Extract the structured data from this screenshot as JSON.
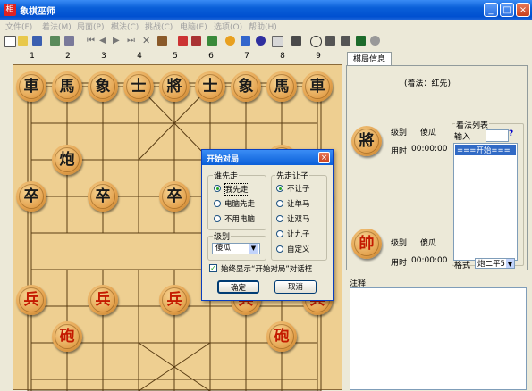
{
  "window": {
    "title": "象棋巫师",
    "app_icon_glyph": "相"
  },
  "menu": [
    "文件(F)",
    "着法(M)",
    "局面(P)",
    "棋法(C)",
    "挑战(C)",
    "电脑(E)",
    "选项(O)",
    "帮助(H)"
  ],
  "board": {
    "column_numbers": [
      "1",
      "2",
      "3",
      "4",
      "5",
      "6",
      "7",
      "8",
      "9"
    ],
    "black_back_row": [
      "車",
      "馬",
      "象",
      "士",
      "將",
      "士",
      "象",
      "馬",
      "車"
    ],
    "black_cannon": "炮",
    "black_soldier": "卒",
    "red_soldier": "兵",
    "red_cannon": "砲"
  },
  "right_panel": {
    "tab_label": "棋局信息",
    "moves_first": "(着法：红先)",
    "top_player": {
      "piece": "將",
      "level_label": "级别",
      "level_value": "傻瓜",
      "time_label": "用时",
      "time_value": "00:00:00"
    },
    "bottom_player": {
      "piece": "帥",
      "level_label": "级别",
      "level_value": "傻瓜",
      "time_label": "用时",
      "time_value": "00:00:00"
    },
    "moves_list_label": "着法列表",
    "input_label": "输入",
    "help_link": "?",
    "moves_list_items": [
      "===开始==="
    ],
    "format_label": "格式",
    "format_value": "炮二平5",
    "notes_label": "注释"
  },
  "dialog": {
    "title": "开始对局",
    "who_first_label": "谁先走",
    "who_first_options": [
      "我先走",
      "电脑先走",
      "不用电脑"
    ],
    "who_first_selected": 0,
    "handicap_label": "先走让子",
    "handicap_options": [
      "不让子",
      "让单马",
      "让双马",
      "让九子",
      "自定义"
    ],
    "handicap_selected": 0,
    "level_label": "级别",
    "level_value": "傻瓜",
    "always_show_label": "始终显示“开始对局”对话框",
    "ok_label": "确定",
    "cancel_label": "取消"
  }
}
